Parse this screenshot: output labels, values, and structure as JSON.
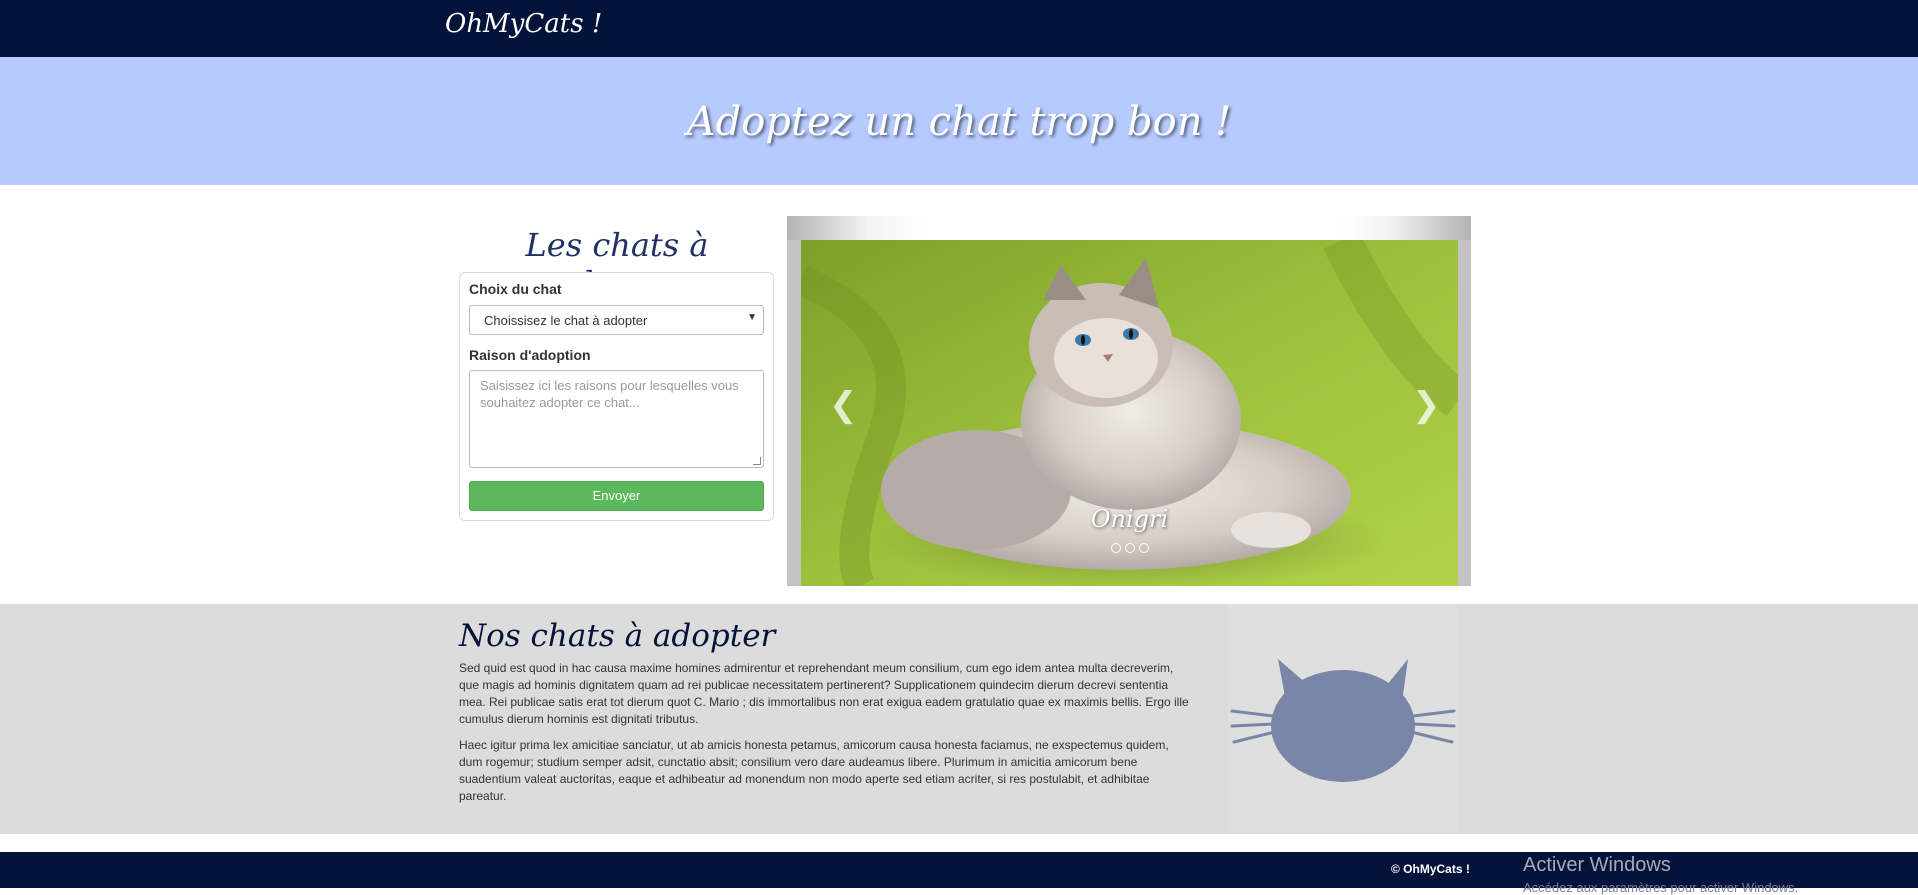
{
  "brand": "OhMyCats !",
  "hero": {
    "title": "Adoptez un chat trop bon !"
  },
  "form": {
    "title": "Les chats à adopter",
    "choice_label": "Choix du chat",
    "choice_value": "Choissisez le chat à adopter",
    "reason_label": "Raison d'adoption",
    "reason_placeholder": "Saisissez ici les raisons pour lesquelles vous souhaitez adopter ce chat...",
    "submit_label": "Envoyer"
  },
  "carousel": {
    "caption": "Onigri",
    "prev_icon": "chevron-left-icon",
    "next_icon": "chevron-right-icon",
    "slide_count": 3,
    "prev_glyph": "❮",
    "next_glyph": "❯"
  },
  "about": {
    "title": "Nos chats à adopter",
    "paragraphs": [
      "Sed quid est quod in hac causa maxime homines admirentur et reprehendant meum consilium, cum ego idem antea multa decreverim, que magis ad hominis dignitatem quam ad rei publicae necessitatem pertinerent? Supplicationem quindecim dierum decrevi sententia mea. Rei publicae satis erat tot dierum quot C. Mario ; dis immortalibus non erat exigua eadem gratulatio quae ex maximis bellis. Ergo ille cumulus dierum hominis est dignitati tributus.",
      "Haec igitur prima lex amicitiae sanciatur, ut ab amicis honesta petamus, amicorum causa honesta faciamus, ne exspectemus quidem, dum rogemur; studium semper adsit, cunctatio absit; consilium vero dare audeamus libere. Plurimum in amicitia amicorum bene suadentium valeat auctoritas, eaque et adhibeatur ad monendum non modo aperte sed etiam acriter, si res postulabit, et adhibitae pareatur."
    ],
    "illustration_icon": "cat-head-icon"
  },
  "footer": {
    "copyright": "© OhMyCats !",
    "watermark": "Activer Windows",
    "watermark_sub": "Accédez aux paramètres pour activer Windows."
  },
  "colors": {
    "navy": "#04133a",
    "hero_bg": "#b6caff",
    "accent_green": "#5cb85c",
    "cat_icon": "#7a86a8"
  }
}
